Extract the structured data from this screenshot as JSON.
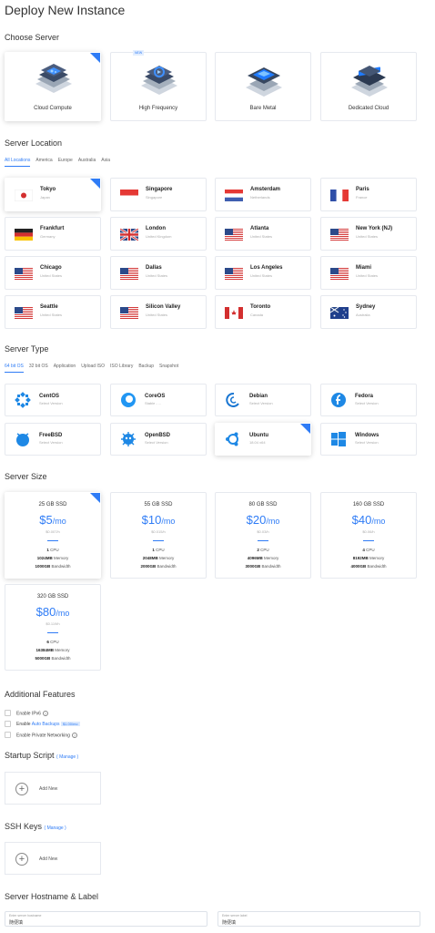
{
  "page_title": "Deploy New Instance",
  "sections": {
    "choose_server": "Choose Server",
    "server_location": "Server Location",
    "server_type": "Server Type",
    "server_size": "Server Size",
    "additional_features": "Additional Features",
    "startup_script": "Startup Script",
    "ssh_keys": "SSH Keys",
    "hostname_label": "Server Hostname & Label"
  },
  "servers": [
    {
      "name": "Cloud Compute",
      "badge": "",
      "selected": true
    },
    {
      "name": "High Frequency",
      "badge": "NEW",
      "selected": false
    },
    {
      "name": "Bare Metal",
      "badge": "",
      "selected": false
    },
    {
      "name": "Dedicated Cloud",
      "badge": "",
      "selected": false
    }
  ],
  "location_tabs": [
    "All Locations",
    "America",
    "Europe",
    "Australia",
    "Asia"
  ],
  "locations": [
    {
      "city": "Tokyo",
      "country": "Japan",
      "flag": "jp"
    },
    {
      "city": "Singapore",
      "country": "Singapore",
      "flag": "sg"
    },
    {
      "city": "Amsterdam",
      "country": "Netherlands",
      "flag": "nl"
    },
    {
      "city": "Paris",
      "country": "France",
      "flag": "fr"
    },
    {
      "city": "Frankfurt",
      "country": "Germany",
      "flag": "de"
    },
    {
      "city": "London",
      "country": "United Kingdom",
      "flag": "gb"
    },
    {
      "city": "Atlanta",
      "country": "United States",
      "flag": "us"
    },
    {
      "city": "New York (NJ)",
      "country": "United States",
      "flag": "us"
    },
    {
      "city": "Chicago",
      "country": "United States",
      "flag": "us"
    },
    {
      "city": "Dallas",
      "country": "United States",
      "flag": "us"
    },
    {
      "city": "Los Angeles",
      "country": "United States",
      "flag": "us"
    },
    {
      "city": "Miami",
      "country": "United States",
      "flag": "us"
    },
    {
      "city": "Seattle",
      "country": "United States",
      "flag": "us"
    },
    {
      "city": "Silicon Valley",
      "country": "United States",
      "flag": "us"
    },
    {
      "city": "Toronto",
      "country": "Canada",
      "flag": "ca"
    },
    {
      "city": "Sydney",
      "country": "Australia",
      "flag": "au"
    }
  ],
  "type_tabs": [
    "64 bit OS",
    "32 bit OS",
    "Application",
    "Upload ISO",
    "ISO Library",
    "Backup",
    "Snapshot"
  ],
  "os": [
    {
      "name": "CentOS",
      "sub": "Select Version",
      "icon": "centos-icon",
      "color": "#1e88e5"
    },
    {
      "name": "CoreOS",
      "sub": "Stable - ...",
      "icon": "coreos-icon",
      "color": "#2196f3"
    },
    {
      "name": "Debian",
      "sub": "Select Version",
      "icon": "debian-icon",
      "color": "#1976d2"
    },
    {
      "name": "Fedora",
      "sub": "Select Version",
      "icon": "fedora-icon",
      "color": "#1e88e5"
    },
    {
      "name": "FreeBSD",
      "sub": "Select Version",
      "icon": "freebsd-icon",
      "color": "#1e88e5"
    },
    {
      "name": "OpenBSD",
      "sub": "Select Version",
      "icon": "openbsd-icon",
      "color": "#1e88e5"
    },
    {
      "name": "Ubuntu",
      "sub": "18.04 x64",
      "icon": "ubuntu-icon",
      "color": "#1e88e5"
    },
    {
      "name": "Windows",
      "sub": "Select Version",
      "icon": "windows-icon",
      "color": "#1e88e5"
    }
  ],
  "sizes": [
    {
      "ssd": "25 GB SSD",
      "price": "$5",
      "per": "/mo",
      "hourly": "$0.007/h",
      "cpu": "1",
      "mem": "1024MB",
      "bw": "1000GB"
    },
    {
      "ssd": "55 GB SSD",
      "price": "$10",
      "per": "/mo",
      "hourly": "$0.015/h",
      "cpu": "1",
      "mem": "2048MB",
      "bw": "2000GB"
    },
    {
      "ssd": "80 GB SSD",
      "price": "$20",
      "per": "/mo",
      "hourly": "$0.03/h",
      "cpu": "2",
      "mem": "4096MB",
      "bw": "3000GB"
    },
    {
      "ssd": "160 GB SSD",
      "price": "$40",
      "per": "/mo",
      "hourly": "$0.06/h",
      "cpu": "4",
      "mem": "8192MB",
      "bw": "4000GB"
    },
    {
      "ssd": "320 GB SSD",
      "price": "$80",
      "per": "/mo",
      "hourly": "$0.119/h",
      "cpu": "6",
      "mem": "16384MB",
      "bw": "5000GB"
    }
  ],
  "size_labels": {
    "cpu": "CPU",
    "memory": "Memory",
    "bandwidth": "Bandwidth"
  },
  "features": {
    "ipv6": "Enable IPv6",
    "backups_prefix": "Enable",
    "backups_link": "Auto Backups",
    "backups_price": "$1.00/mo",
    "private": "Enable Private Networking"
  },
  "manage": "( Manage )",
  "add_new": "Add New",
  "hostname": {
    "placeholder": "Enter server hostname",
    "value": "随便填"
  },
  "label": {
    "placeholder": "Enter server label",
    "value": "随便填"
  },
  "accent": "#2f7cf6"
}
